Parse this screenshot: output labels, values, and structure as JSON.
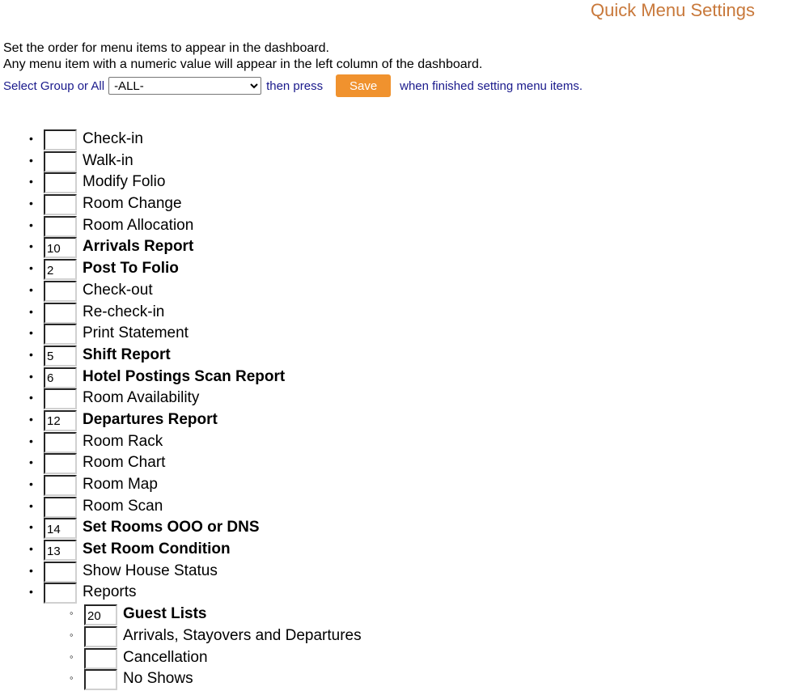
{
  "header": {
    "title": "Quick Menu Settings"
  },
  "description": {
    "line1": "Set the order for menu items to appear in the dashboard.",
    "line2": "Any menu item with a numeric value will appear in the left column of the dashboard."
  },
  "controls": {
    "select_label": "Select Group or All",
    "select_value": "-ALL-",
    "then_press": "then press",
    "save_label": "Save",
    "after_save": "when finished setting menu items."
  },
  "colors": {
    "title": "#c8783a",
    "save_button": "#f0922e",
    "controls_text": "#1a1a8c"
  },
  "items": [
    {
      "label": "Check-in",
      "value": "",
      "bold": false
    },
    {
      "label": "Walk-in",
      "value": "",
      "bold": false
    },
    {
      "label": "Modify Folio",
      "value": "",
      "bold": false
    },
    {
      "label": "Room Change",
      "value": "",
      "bold": false
    },
    {
      "label": "Room Allocation",
      "value": "",
      "bold": false
    },
    {
      "label": "Arrivals Report",
      "value": "10",
      "bold": true
    },
    {
      "label": "Post To Folio",
      "value": "2",
      "bold": true
    },
    {
      "label": "Check-out",
      "value": "",
      "bold": false
    },
    {
      "label": "Re-check-in",
      "value": "",
      "bold": false
    },
    {
      "label": "Print Statement",
      "value": "",
      "bold": false
    },
    {
      "label": "Shift Report",
      "value": "5",
      "bold": true
    },
    {
      "label": "Hotel Postings Scan Report",
      "value": "6",
      "bold": true
    },
    {
      "label": "Room Availability",
      "value": "",
      "bold": false
    },
    {
      "label": "Departures Report",
      "value": "12",
      "bold": true
    },
    {
      "label": "Room Rack",
      "value": "",
      "bold": false
    },
    {
      "label": "Room Chart",
      "value": "",
      "bold": false
    },
    {
      "label": "Room Map",
      "value": "",
      "bold": false
    },
    {
      "label": "Room Scan",
      "value": "",
      "bold": false
    },
    {
      "label": "Set Rooms OOO or DNS",
      "value": "14",
      "bold": true
    },
    {
      "label": "Set Room Condition",
      "value": "13",
      "bold": true
    },
    {
      "label": "Show House Status",
      "value": "",
      "bold": false
    },
    {
      "label": "Reports",
      "value": "",
      "bold": false
    }
  ],
  "sub_items": [
    {
      "label": "Guest Lists",
      "value": "20",
      "bold": true
    },
    {
      "label": "Arrivals, Stayovers and Departures",
      "value": "",
      "bold": false
    },
    {
      "label": "Cancellation",
      "value": "",
      "bold": false
    },
    {
      "label": "No Shows",
      "value": "",
      "bold": false
    }
  ]
}
